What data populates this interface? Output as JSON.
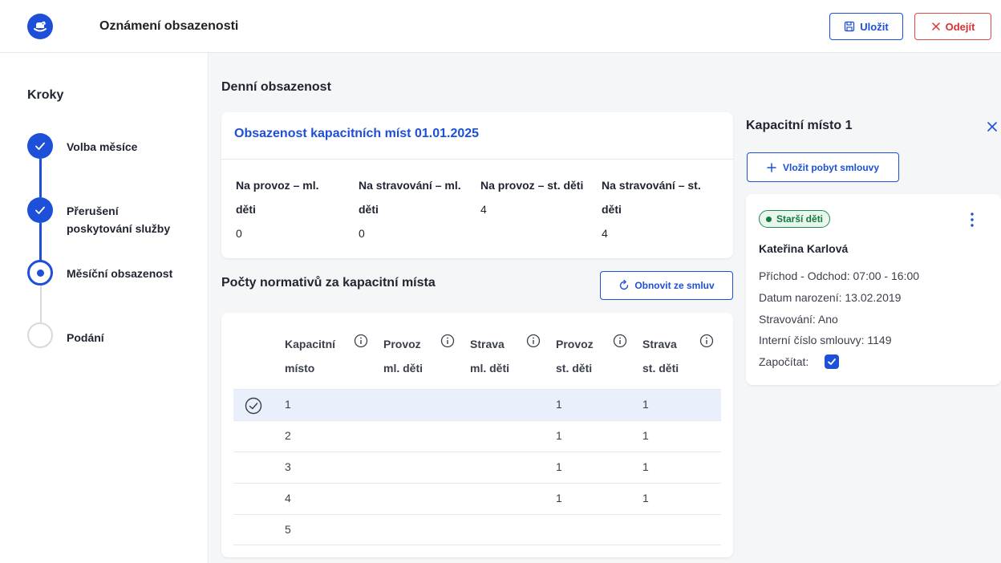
{
  "header": {
    "title": "Oznámení obsazenosti",
    "save_label": "Uložit",
    "leave_label": "Odejít"
  },
  "sidebar": {
    "title": "Kroky",
    "steps": [
      {
        "label": "Volba měsíce",
        "state": "done"
      },
      {
        "label": "Přerušení",
        "label2": "poskytování služby",
        "state": "done"
      },
      {
        "label": "Měsíční obsazenost",
        "state": "current"
      },
      {
        "label": "Podání",
        "state": "todo"
      }
    ]
  },
  "main": {
    "daily_title": "Denní obsazenost",
    "summary": {
      "title": "Obsazenost kapacitních míst 01.01.2025",
      "columns": [
        {
          "head1": "Na provoz – ml.",
          "head2": "děti",
          "value": "0"
        },
        {
          "head1": "Na stravování – ml.",
          "head2": "děti",
          "value": "0"
        },
        {
          "head1": "Na provoz – st. děti",
          "head2": "",
          "value": "4"
        },
        {
          "head1": "Na stravování – st.",
          "head2": "děti",
          "value": "4"
        }
      ]
    },
    "norms_title": "Počty normativů za kapacitní místa",
    "refresh_label": "Obnovit ze smluv",
    "table": {
      "headers": [
        {
          "line1": "Kapacitní",
          "line2": "místo"
        },
        {
          "line1": "Provoz",
          "line2": "ml. děti"
        },
        {
          "line1": "Strava",
          "line2": "ml. děti"
        },
        {
          "line1": "Provoz",
          "line2": "st. děti"
        },
        {
          "line1": "Strava",
          "line2": "st. děti"
        }
      ],
      "rows": [
        {
          "place": "1",
          "provoz_ml": "",
          "strava_ml": "",
          "provoz_st": "1",
          "strava_st": "1",
          "selected": true
        },
        {
          "place": "2",
          "provoz_ml": "",
          "strava_ml": "",
          "provoz_st": "1",
          "strava_st": "1",
          "selected": false
        },
        {
          "place": "3",
          "provoz_ml": "",
          "strava_ml": "",
          "provoz_st": "1",
          "strava_st": "1",
          "selected": false
        },
        {
          "place": "4",
          "provoz_ml": "",
          "strava_ml": "",
          "provoz_st": "1",
          "strava_st": "1",
          "selected": false
        },
        {
          "place": "5",
          "provoz_ml": "",
          "strava_ml": "",
          "provoz_st": "",
          "strava_st": "",
          "selected": false
        }
      ]
    }
  },
  "panel": {
    "title": "Kapacitní místo 1",
    "add_label": "Vložit pobyt smlouvy",
    "card": {
      "badge": "Starší děti",
      "name": "Kateřina Karlová",
      "arrival": "Příchod - Odchod: 07:00 - 16:00",
      "birth": "Datum narození: 13.02.2019",
      "meals": "Stravování: Ano",
      "contract": "Interní číslo smlouvy: 1149",
      "count_label": "Započítat:",
      "count_checked": true
    }
  },
  "colors": {
    "primary": "#1d4fd8",
    "danger": "#d93030",
    "success": "#137a3d",
    "selected_row": "#e9f0fb",
    "background": "#f5f6f8"
  }
}
